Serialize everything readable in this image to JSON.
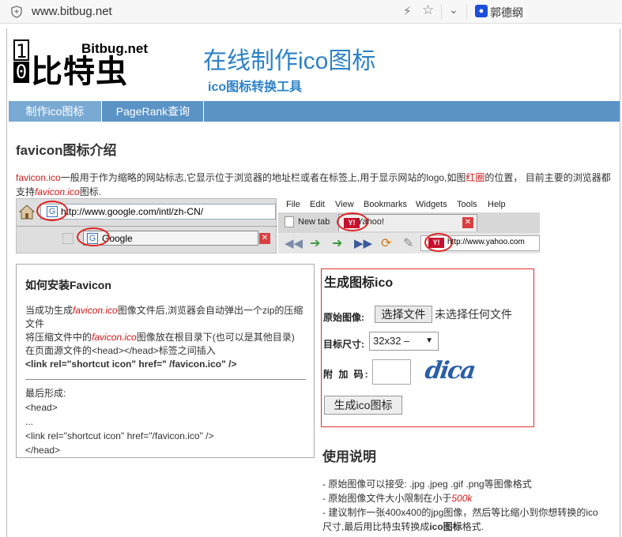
{
  "browser": {
    "url": "www.bitbug.net",
    "bookmark_label": "郭德纲"
  },
  "site": {
    "logo_digits": [
      "1",
      "0"
    ],
    "logo_cn": "比特虫",
    "logo_en": "Bitbug.net",
    "title": "在线制作ico图标",
    "subtitle": "ico图标转换工具"
  },
  "nav": {
    "items": [
      "制作ico图标",
      "PageRank查询"
    ]
  },
  "intro": {
    "heading": "favicon图标介绍",
    "lead": "favicon.ico",
    "text_a": "一般用于作为缩略的网站标志,它显示位于浏览器的地址栏或者在标签上,用于显示网站的logo,如图",
    "text_red": "红圈",
    "text_b": "的位置， 目前主要的浏览器都支持",
    "text_em": "favicon.ico",
    "text_c": "图标."
  },
  "strip": {
    "ie_url": "http://www.google.com/intl/zh-CN/",
    "ie_tab": "Google",
    "ie_tab_icon": "G",
    "ie_url_icon": "G",
    "ff_menu": [
      "File",
      "Edit",
      "View",
      "Bookmarks",
      "Widgets",
      "Tools",
      "Help"
    ],
    "ff_tab1": "New tab",
    "ff_tab2": "Yahoo!",
    "ff_url": "http://www.yahoo.com",
    "yahoo_icon": "Y!"
  },
  "install": {
    "heading": "如何安装Favicon",
    "line1_a": "当成功生成",
    "line1_em": "favicon.ico",
    "line1_b": "图像文件后,浏览器会自动弹出一个zip的压缩文件",
    "line2_a": "将压缩文件中的",
    "line2_em": "favicon.ico",
    "line2_b": "图像放在根目录下(也可以是其他目录)",
    "line3": "在页面源文件的<head></head>标签之间插入",
    "line4": "<link rel=\"shortcut icon\" href=\" /favicon.ico\" />",
    "code_title": "最后形成:",
    "code1": "<head>",
    "code2": "...",
    "code3": "<link rel=\"shortcut icon\" href=\"/favicon.ico\" />",
    "code4": "</head>"
  },
  "generator": {
    "heading": "生成图标ico",
    "source_label": "原始图像:",
    "file_button": "选择文件",
    "file_state": "未选择任何文件",
    "size_label": "目标尺寸:",
    "size_value": "32x32 –",
    "code_label": "附 加 码:",
    "code_value": "",
    "captcha": "dica",
    "submit": "生成ico图标"
  },
  "usage": {
    "heading": "使用说明",
    "item1": "- 原始图像可以接受: .jpg .jpeg .gif .png等图像格式",
    "item2_a": "- 原始图像文件大小限制在小于",
    "item2_em": "500k",
    "item3_a": "- 建议制作一张400x400的jpg图像，然后等比缩小到你想转换的ico尺寸,最后用比特虫转换成",
    "item3_b": "ico图标",
    "item3_c": "格式."
  }
}
